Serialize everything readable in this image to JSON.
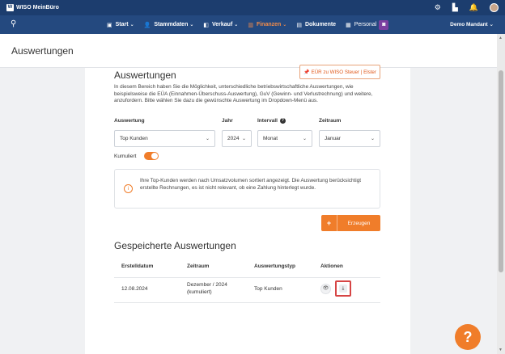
{
  "app": {
    "logo_mark": "W",
    "name": "WISO MeinBüro"
  },
  "topbar": {
    "icons": [
      "gear-icon",
      "org-icon",
      "bell-icon",
      "avatar"
    ],
    "gear_glyph": "⚙",
    "org_glyph": "▙",
    "bell_glyph": "🔔"
  },
  "nav": {
    "search_glyph": "⚲",
    "items": [
      {
        "label": "Start",
        "icon": "▣",
        "chevron": "⌄"
      },
      {
        "label": "Stammdaten",
        "icon": "👤",
        "chevron": "⌄"
      },
      {
        "label": "Verkauf",
        "icon": "◧",
        "chevron": "⌄"
      },
      {
        "label": "Finanzen",
        "icon": "▥",
        "chevron": "⌄"
      },
      {
        "label": "Dokumente",
        "icon": "▤"
      },
      {
        "label": "Personal",
        "icon": "▦",
        "badge": "◙"
      }
    ],
    "active_item": "Finanzen",
    "mandant": "Demo Mandant",
    "mandant_chevron": "⌄"
  },
  "page": {
    "title": "Auswertungen"
  },
  "section": {
    "title": "Auswertungen",
    "steuer_button": "EÜR zu WISO Steuer | Elster",
    "steuer_icon": "📌",
    "intro": "In diesem Bereich haben Sie die Möglichkeit, unterschiedliche betriebswirtschaftliche Auswertungen, wie beispielsweise die EÜA (Einnahmen-Überschuss-Auswertung), GuV (Gewinn- und Verlustrechnung) und weitere, anzufordern. Bitte wählen Sie dazu die gewünschte Auswertung im Dropdown-Menü aus."
  },
  "form": {
    "auswertung": {
      "label": "Auswertung",
      "value": "Top Kunden"
    },
    "jahr": {
      "label": "Jahr",
      "value": "2024"
    },
    "intervall": {
      "label": "Intervall",
      "value": "Monat",
      "help": "?"
    },
    "zeitraum": {
      "label": "Zeitraum",
      "value": "Januar"
    },
    "chevron": "⌄",
    "kumuliert": {
      "label": "Kumuliert",
      "on": true
    }
  },
  "info": {
    "icon": "i",
    "text": "Ihre Top-Kunden werden nach Umsatzvolumen sortiert angezeigt. Die Auswertung berücksichtigt erstellte Rechnungen, es ist nicht relevant, ob eine Zahlung hinterlegt wurde."
  },
  "generate": {
    "plus": "+",
    "label": "Erzeugen"
  },
  "saved": {
    "title": "Gespeicherte Auswertungen",
    "columns": [
      "Erstelldatum",
      "Zeitraum",
      "Auswertungstyp",
      "Aktionen"
    ],
    "rows": [
      {
        "erstelldatum": "12.08.2024",
        "zeitraum_line1": "Dezember / 2024",
        "zeitraum_line2": "(kumuliert)",
        "typ": "Top Kunden",
        "view_glyph": "👁",
        "download_glyph": "⤓"
      }
    ]
  },
  "help_fab": "?",
  "scrollbar": {
    "up": "▲",
    "down": "▼"
  },
  "colors": {
    "topbar": "#1c3d6e",
    "navbar": "#24497f",
    "accent": "#f07d2a",
    "highlight": "#d64545"
  }
}
